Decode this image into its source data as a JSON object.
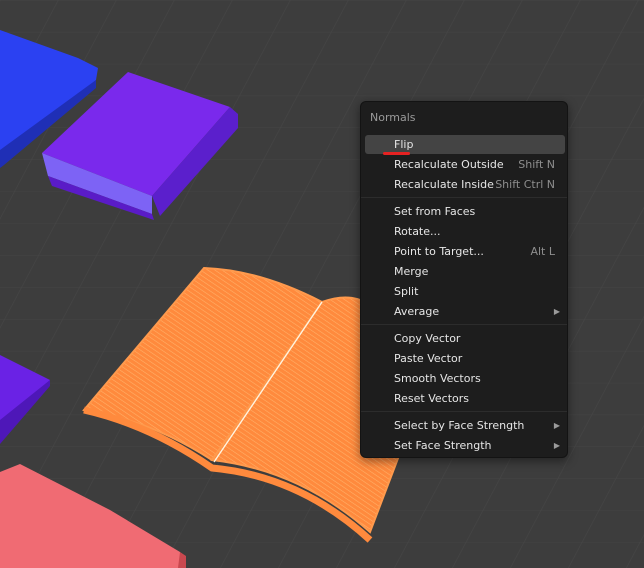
{
  "menu": {
    "title": "Normals",
    "items": [
      {
        "label": "Flip",
        "shortcut": ""
      },
      {
        "label": "Recalculate Outside",
        "shortcut": "Shift N"
      },
      {
        "label": "Recalculate Inside",
        "shortcut": "Shift Ctrl N"
      },
      {
        "label": "Set from Faces",
        "shortcut": ""
      },
      {
        "label": "Rotate...",
        "shortcut": ""
      },
      {
        "label": "Point to Target...",
        "shortcut": "Alt L"
      },
      {
        "label": "Merge",
        "shortcut": ""
      },
      {
        "label": "Split",
        "shortcut": ""
      },
      {
        "label": "Average",
        "shortcut": ""
      },
      {
        "label": "Copy Vector",
        "shortcut": ""
      },
      {
        "label": "Paste Vector",
        "shortcut": ""
      },
      {
        "label": "Smooth Vectors",
        "shortcut": ""
      },
      {
        "label": "Reset Vectors",
        "shortcut": ""
      },
      {
        "label": "Select by Face Strength",
        "shortcut": ""
      },
      {
        "label": "Set Face Strength",
        "shortcut": ""
      }
    ],
    "submenu_arrow": "▶"
  },
  "colors": {
    "viewport_bg": "#3d3d3d",
    "blue_book": "#2b41f2",
    "purple_book": "#7326e6",
    "selected_orange": "#ff8a3d",
    "pink_object": "#f06b73",
    "annotation_red": "#e52222"
  }
}
